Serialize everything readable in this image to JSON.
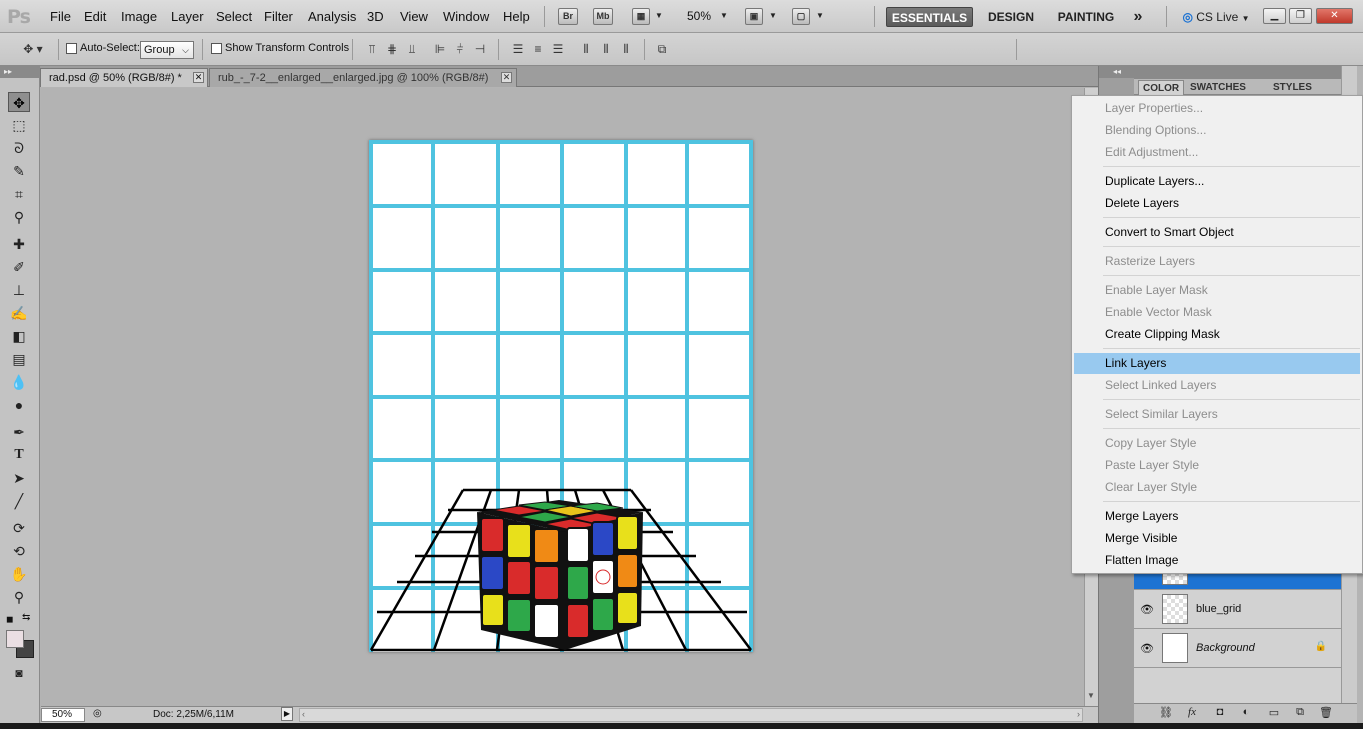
{
  "app": {
    "logo": "Ps"
  },
  "menu": [
    "File",
    "Edit",
    "Image",
    "Layer",
    "Select",
    "Filter",
    "Analysis",
    "3D",
    "View",
    "Window",
    "Help"
  ],
  "menubar_buttons": {
    "bridge": "Br",
    "minibridge": "Mb",
    "zoom": "50%"
  },
  "workspaces": {
    "essentials": "ESSENTIALS",
    "design": "DESIGN",
    "painting": "PAINTING",
    "more": "»",
    "cs_live": "CS Live"
  },
  "options": {
    "auto_select_label": "Auto-Select:",
    "auto_select_value": "Group",
    "transform_label": "Show Transform Controls"
  },
  "tabs": [
    {
      "label": "rad.psd @ 50% (RGB/8#) *",
      "active": true
    },
    {
      "label": "rub_-_7-2__enlarged__enlarged.jpg @ 100% (RGB/8#)",
      "active": false
    }
  ],
  "status": {
    "zoom": "50%",
    "doc": "Doc: 2,25M/6,11M"
  },
  "panel": {
    "tabs": [
      "COLOR",
      "SWATCHES",
      "STYLES"
    ]
  },
  "layers": [
    {
      "name": "blue_grid",
      "thumb": "checker",
      "italic": false,
      "locked": false
    },
    {
      "name": "Background",
      "thumb": "white",
      "italic": true,
      "locked": true
    }
  ],
  "context_menu": {
    "items": [
      {
        "label": "Layer Properties...",
        "state": "disabled"
      },
      {
        "label": "Blending Options...",
        "state": "disabled"
      },
      {
        "label": "Edit Adjustment...",
        "state": "disabled"
      },
      {
        "label": "Duplicate Layers...",
        "state": "enabled"
      },
      {
        "label": "Delete Layers",
        "state": "enabled"
      },
      {
        "label": "Convert to Smart Object",
        "state": "enabled"
      },
      {
        "label": "Rasterize Layers",
        "state": "disabled"
      },
      {
        "label": "Enable Layer Mask",
        "state": "disabled"
      },
      {
        "label": "Enable Vector Mask",
        "state": "disabled"
      },
      {
        "label": "Create Clipping Mask",
        "state": "enabled"
      },
      {
        "label": "Link Layers",
        "state": "highlight"
      },
      {
        "label": "Select Linked Layers",
        "state": "disabled"
      },
      {
        "label": "Select Similar Layers",
        "state": "disabled"
      },
      {
        "label": "Copy Layer Style",
        "state": "disabled"
      },
      {
        "label": "Paste Layer Style",
        "state": "disabled"
      },
      {
        "label": "Clear Layer Style",
        "state": "disabled"
      },
      {
        "label": "Merge Layers",
        "state": "enabled"
      },
      {
        "label": "Merge Visible",
        "state": "enabled"
      },
      {
        "label": "Flatten Image",
        "state": "enabled"
      }
    ]
  },
  "colors": {
    "grid_blue": "#4fc3e0",
    "selection": "#98c9ef",
    "layer_selected": "#1d73d3"
  },
  "tools": [
    "move-icon",
    "marquee-icon",
    "lasso-icon",
    "quick-select-icon",
    "crop-icon",
    "eyedropper-icon",
    "healing-icon",
    "brush-icon",
    "stamp-icon",
    "history-brush-icon",
    "eraser-icon",
    "gradient-icon",
    "blur-icon",
    "dodge-icon",
    "pen-icon",
    "type-icon",
    "path-select-icon",
    "line-icon",
    "3d-rotate-icon",
    "3d-orbit-icon",
    "hand-icon",
    "zoom-icon"
  ]
}
